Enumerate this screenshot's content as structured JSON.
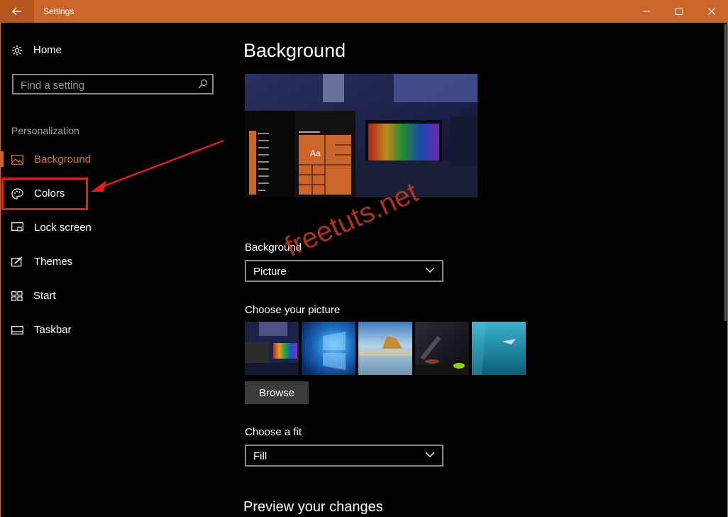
{
  "window": {
    "title": "Settings"
  },
  "sidebar": {
    "home_label": "Home",
    "search_placeholder": "Find a setting",
    "section_label": "Personalization",
    "items": [
      {
        "label": "Background",
        "icon": "picture-icon",
        "active": true
      },
      {
        "label": "Colors",
        "icon": "palette-icon",
        "active": false
      },
      {
        "label": "Lock screen",
        "icon": "lock-screen-icon",
        "active": false
      },
      {
        "label": "Themes",
        "icon": "themes-icon",
        "active": false
      },
      {
        "label": "Start",
        "icon": "start-icon",
        "active": false
      },
      {
        "label": "Taskbar",
        "icon": "taskbar-icon",
        "active": false
      }
    ]
  },
  "main": {
    "title": "Background",
    "preview": {
      "sample_text": "Aa"
    },
    "background_field": {
      "label": "Background",
      "value": "Picture"
    },
    "choose_picture_label": "Choose your picture",
    "browse_label": "Browse",
    "fit_field": {
      "label": "Choose a fit",
      "value": "Fill"
    },
    "preview_changes_label": "Preview your changes"
  },
  "watermark": "freetuts.net",
  "colors": {
    "accent": "#cc6529",
    "annotation": "#e31b1b"
  }
}
